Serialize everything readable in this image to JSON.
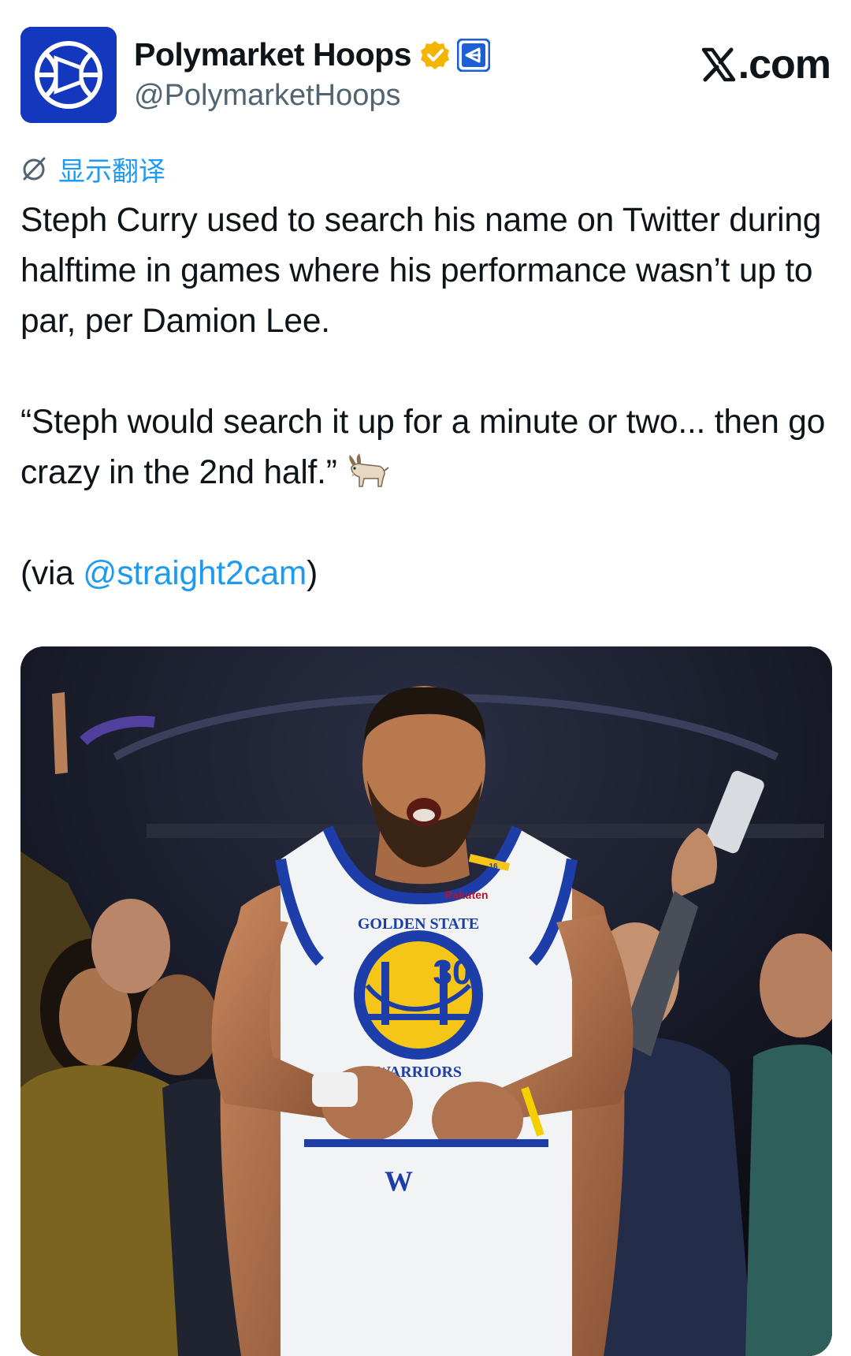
{
  "author": {
    "name": "Polymarket Hoops",
    "handle": "@PolymarketHoops",
    "verified_badge_color": "#f4b400",
    "affiliate_badge_color": "#1d5fd8",
    "avatar_icon": "polymarket-basketball-icon",
    "avatar_color": "#1338be"
  },
  "site": {
    "logo_text": ".com",
    "logo_icon": "x-logo-icon"
  },
  "translate": {
    "label": "显示翻译",
    "icon": "translate-globe-icon",
    "color": "#1d9bf0"
  },
  "tweet": {
    "paragraph1": "Steph Curry used to search his name on Twitter during halftime in games where his performance wasn’t up to par, per Damion Lee.",
    "paragraph2": "“Steph would search it up for a minute or two... then go crazy in the 2nd half.”",
    "emoji": "goat-emoji",
    "via_prefix": "(via ",
    "mention": "@straight2cam",
    "via_suffix": ")",
    "link_color": "#1d9bf0"
  },
  "media": {
    "jersey_number": "30",
    "jersey_team_top": "GOLDEN STATE",
    "jersey_team_bottom": "WARRIORS",
    "sponsor": "Rakuten",
    "patch_number": "16",
    "shorts_logo": "W"
  }
}
